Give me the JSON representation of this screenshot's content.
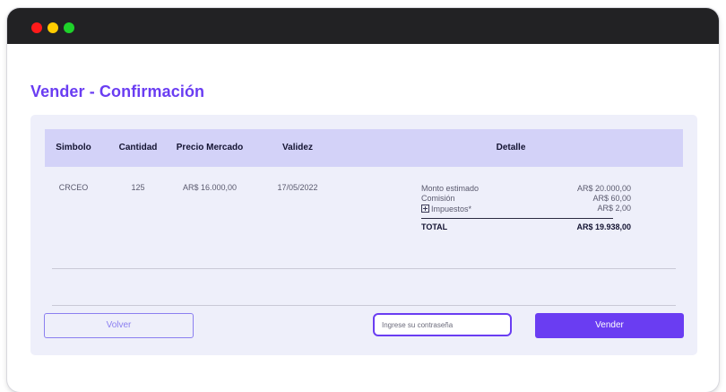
{
  "window": {
    "controls": [
      {
        "name": "close",
        "color": "#ff1a1a"
      },
      {
        "name": "minimize",
        "color": "#ffcc00"
      },
      {
        "name": "maximize",
        "color": "#1ed22a"
      }
    ]
  },
  "page": {
    "title": "Vender - Confirmación"
  },
  "table": {
    "headers": {
      "symbol": "Simbolo",
      "quantity": "Cantidad",
      "market_price": "Precio Mercado",
      "validity": "Validez",
      "detail": "Detalle"
    },
    "row": {
      "symbol": "CRCEO",
      "quantity": "125",
      "market_price": "AR$ 16.000,00",
      "validity": "17/05/2022"
    },
    "detail": {
      "items": [
        {
          "label": "Monto estimado",
          "value": "AR$ 20.000,00"
        },
        {
          "label": "Comisión",
          "value": "AR$ 60,00"
        },
        {
          "label": "Impuestos*",
          "value": "AR$ 2,00"
        }
      ],
      "total_label": "TOTAL",
      "total_value": "AR$ 19.938,00"
    }
  },
  "actions": {
    "back_label": "Volver",
    "password_placeholder": "Ingrese su contraseña",
    "sell_label": "Vender"
  },
  "colors": {
    "accent": "#6a3df2",
    "header_bg": "#d3d2f8",
    "panel_bg": "#eeeffa"
  }
}
